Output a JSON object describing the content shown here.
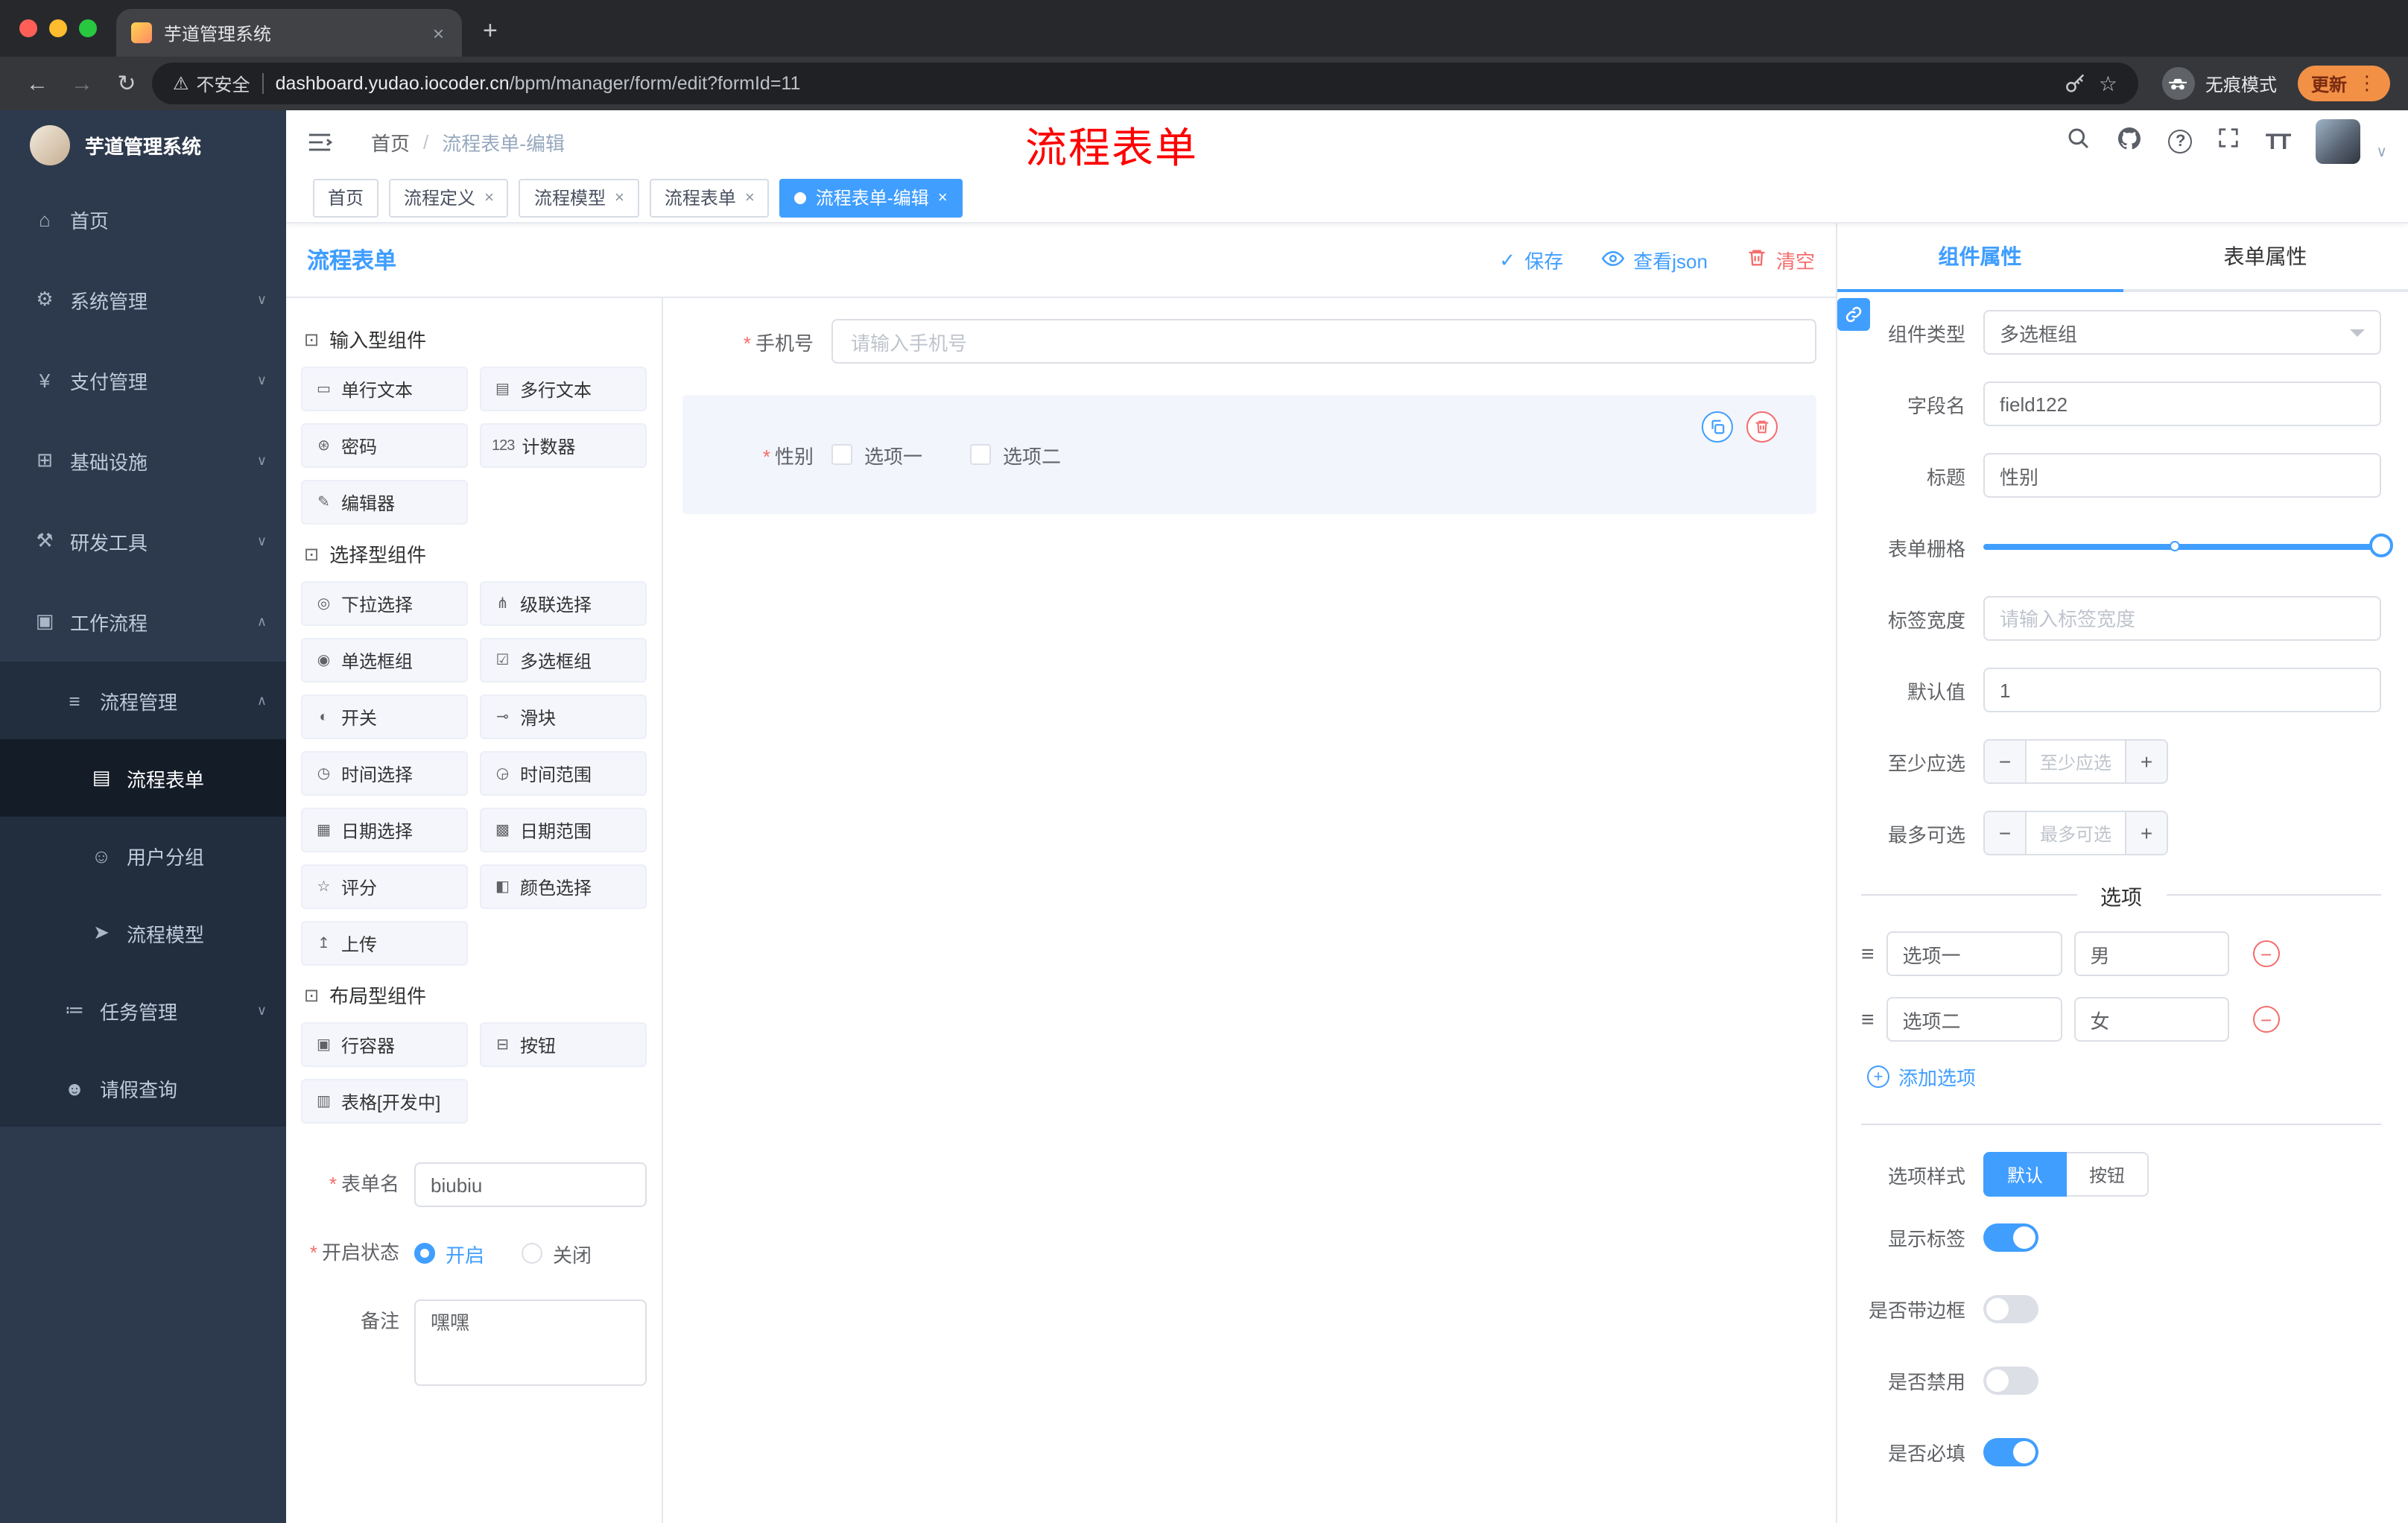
{
  "colors": {
    "accent": "#409eff",
    "danger": "#f56c6c",
    "sidebar_bg": "#2d3a4d"
  },
  "browser": {
    "tab_title": "芋道管理系统",
    "close_tab": "×",
    "new_tab": "+",
    "nav": {
      "back": "←",
      "forward": "→",
      "reload": "↻"
    },
    "security_icon": "⚠",
    "security_label": "不安全",
    "url_domain": "dashboard.yudao.iocoder.cn",
    "url_path": "/bpm/manager/form/edit?formId=11",
    "star": "☆",
    "incognito_label": "无痕模式",
    "update_label": "更新",
    "menu_dots": "⋮"
  },
  "sidebar": {
    "logo_title": "芋道管理系统",
    "menu": [
      {
        "glyph": "⌂",
        "label": "首页",
        "chevron": ""
      },
      {
        "glyph": "⚙",
        "label": "系统管理",
        "chevron": "∨"
      },
      {
        "glyph": "¥",
        "label": "支付管理",
        "chevron": "∨"
      },
      {
        "glyph": "⊞",
        "label": "基础设施",
        "chevron": "∨"
      },
      {
        "glyph": "⚒",
        "label": "研发工具",
        "chevron": "∨"
      },
      {
        "glyph": "▣",
        "label": "工作流程",
        "chevron": "∧"
      },
      {
        "glyph": "≡",
        "label": "流程管理",
        "chevron": "∧"
      },
      {
        "glyph": "▤",
        "label": "流程表单",
        "chevron": ""
      },
      {
        "glyph": "☺",
        "label": "用户分组",
        "chevron": ""
      },
      {
        "glyph": "➤",
        "label": "流程模型",
        "chevron": ""
      },
      {
        "glyph": "≔",
        "label": "任务管理",
        "chevron": "∨"
      },
      {
        "glyph": "☻",
        "label": "请假查询",
        "chevron": ""
      }
    ]
  },
  "header": {
    "breadcrumb": {
      "home": "首页",
      "separator": "/",
      "current": "流程表单-编辑"
    },
    "annotation": "流程表单",
    "font_icon": "TT",
    "question_mark": "?"
  },
  "tags": [
    {
      "label": "首页",
      "close": ""
    },
    {
      "label": "流程定义",
      "close": "×"
    },
    {
      "label": "流程模型",
      "close": "×"
    },
    {
      "label": "流程表单",
      "close": "×"
    },
    {
      "label": "流程表单-编辑",
      "close": "×"
    }
  ],
  "designer": {
    "title": "流程表单",
    "actions": {
      "save_check": "✓",
      "save": "保存",
      "view_json": "查看json",
      "clear": "清空"
    },
    "palette": {
      "sections": [
        {
          "icon_glyph": "⊡",
          "title": "输入型组件",
          "items": [
            {
              "glyph": "▭",
              "label": "单行文本"
            },
            {
              "glyph": "▤",
              "label": "多行文本"
            },
            {
              "glyph": "⊛",
              "label": "密码"
            },
            {
              "glyph": "123",
              "label": "计数器"
            },
            {
              "glyph": "✎",
              "label": "编辑器"
            }
          ]
        },
        {
          "icon_glyph": "⊡",
          "title": "选择型组件",
          "items": [
            {
              "glyph": "◎",
              "label": "下拉选择"
            },
            {
              "glyph": "⋔",
              "label": "级联选择"
            },
            {
              "glyph": "◉",
              "label": "单选框组"
            },
            {
              "glyph": "☑",
              "label": "多选框组"
            },
            {
              "glyph": "◐",
              "label": "开关"
            },
            {
              "glyph": "⊸",
              "label": "滑块"
            },
            {
              "glyph": "◷",
              "label": "时间选择"
            },
            {
              "glyph": "◶",
              "label": "时间范围"
            },
            {
              "glyph": "▦",
              "label": "日期选择"
            },
            {
              "glyph": "▩",
              "label": "日期范围"
            },
            {
              "glyph": "☆",
              "label": "评分"
            },
            {
              "glyph": "◧",
              "label": "颜色选择"
            },
            {
              "glyph": "↥",
              "label": "上传"
            }
          ]
        },
        {
          "icon_glyph": "⊡",
          "title": "布局型组件",
          "items": [
            {
              "glyph": "▣",
              "label": "行容器"
            },
            {
              "glyph": "⊟",
              "label": "按钮"
            },
            {
              "glyph": "▥",
              "label": "表格[开发中]"
            }
          ]
        }
      ]
    },
    "meta": {
      "name_label": "表单名",
      "name_value": "biubiu",
      "status_label": "开启状态",
      "status_on": "开启",
      "status_off": "关闭",
      "remark_label": "备注",
      "remark_value": "嘿嘿"
    },
    "canvas": {
      "phone_label": "手机号",
      "phone_placeholder": "请输入手机号",
      "gender_label": "性别",
      "gender_opt1": "选项一",
      "gender_opt2": "选项二"
    }
  },
  "props": {
    "tab_component": "组件属性",
    "tab_form": "表单属性",
    "component_type_label": "组件类型",
    "component_type_value": "多选框组",
    "field_name_label": "字段名",
    "field_name_value": "field122",
    "title_label": "标题",
    "title_value": "性别",
    "grid_label": "表单栅格",
    "label_width_label": "标签宽度",
    "label_width_placeholder": "请输入标签宽度",
    "default_label": "默认值",
    "default_value": "1",
    "min_label": "至少应选",
    "min_placeholder": "至少应选",
    "max_label": "最多可选",
    "max_placeholder": "最多可选",
    "minus": "−",
    "plus": "+",
    "drag_glyph": "≡",
    "remove_glyph": "−",
    "add_glyph": "+",
    "options_title": "选项",
    "options": [
      {
        "label": "选项一",
        "value": "男"
      },
      {
        "label": "选项二",
        "value": "女"
      }
    ],
    "add_option": "添加选项",
    "style_label": "选项样式",
    "style_default": "默认",
    "style_button": "按钮",
    "toggles": [
      {
        "label": "显示标签",
        "on": true
      },
      {
        "label": "是否带边框",
        "on": false
      },
      {
        "label": "是否禁用",
        "on": false
      },
      {
        "label": "是否必填",
        "on": true
      }
    ]
  }
}
